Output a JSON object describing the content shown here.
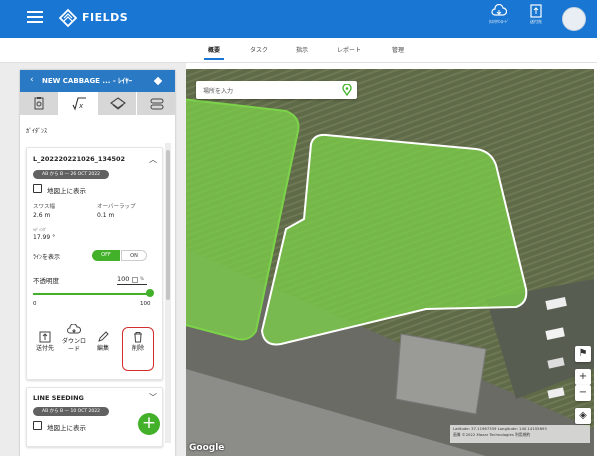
{
  "header": {
    "app_name": "FIELDS",
    "download_label": "ﾀｽｸﾀｳﾝﾛｰﾄﾞ",
    "transfer_label": "送付先",
    "accent_color": "#1976d2"
  },
  "nav_tabs": [
    {
      "label": "概要",
      "active": true
    },
    {
      "label": "タスク"
    },
    {
      "label": "指示"
    },
    {
      "label": "レポート"
    },
    {
      "label": "管理"
    }
  ],
  "panel": {
    "title": "NEW CABBAGE ... - ﾚｲﾔｰ",
    "section_label": "ｶﾞｲﾀﾞﾝｽ",
    "tools": [
      {
        "icon": "soil-sample-icon"
      },
      {
        "icon": "prescription-icon",
        "active": true
      },
      {
        "icon": "layers-icon"
      },
      {
        "icon": "guidance-icon"
      }
    ],
    "layer_card": {
      "name": "L_202220221026_134502",
      "date_badge": "AB から B — 26 OCT 2022",
      "show_on_map_label": "地図上に表示",
      "swath_label": "スワス幅",
      "swath_value": "2.6 m",
      "overlap_label": "オーバーラップ",
      "overlap_value": "0.1 m",
      "heading_label": "ﾍﾃﾞｨﾝｸﾞ",
      "heading_value": "17.99 °",
      "line_display_label": "ﾗｲﾝを表示",
      "toggle_off": "OFF",
      "toggle_on": "ON",
      "opacity_label": "不透明度",
      "opacity_value": "100",
      "opacity_unit": "%",
      "slider_min": "0",
      "slider_max": "100",
      "opacity_fraction": 1.0,
      "actions": {
        "send": "送付先",
        "download": "ダウンロード",
        "edit": "編集",
        "delete": "削除"
      }
    },
    "second_card": {
      "name": "LINE SEEDING",
      "date_badge": "AB から B — 10 OCT 2022",
      "show_on_map_label": "地図上に表示"
    }
  },
  "map": {
    "search_placeholder": "場所を入力",
    "attribution": "Latitude: 37.11967339 Longitude: 140.14155893",
    "copyright": "画像 ©2022 Maxar Technologies 利用規約",
    "google": "Google",
    "field_color": "#7cd34a"
  }
}
